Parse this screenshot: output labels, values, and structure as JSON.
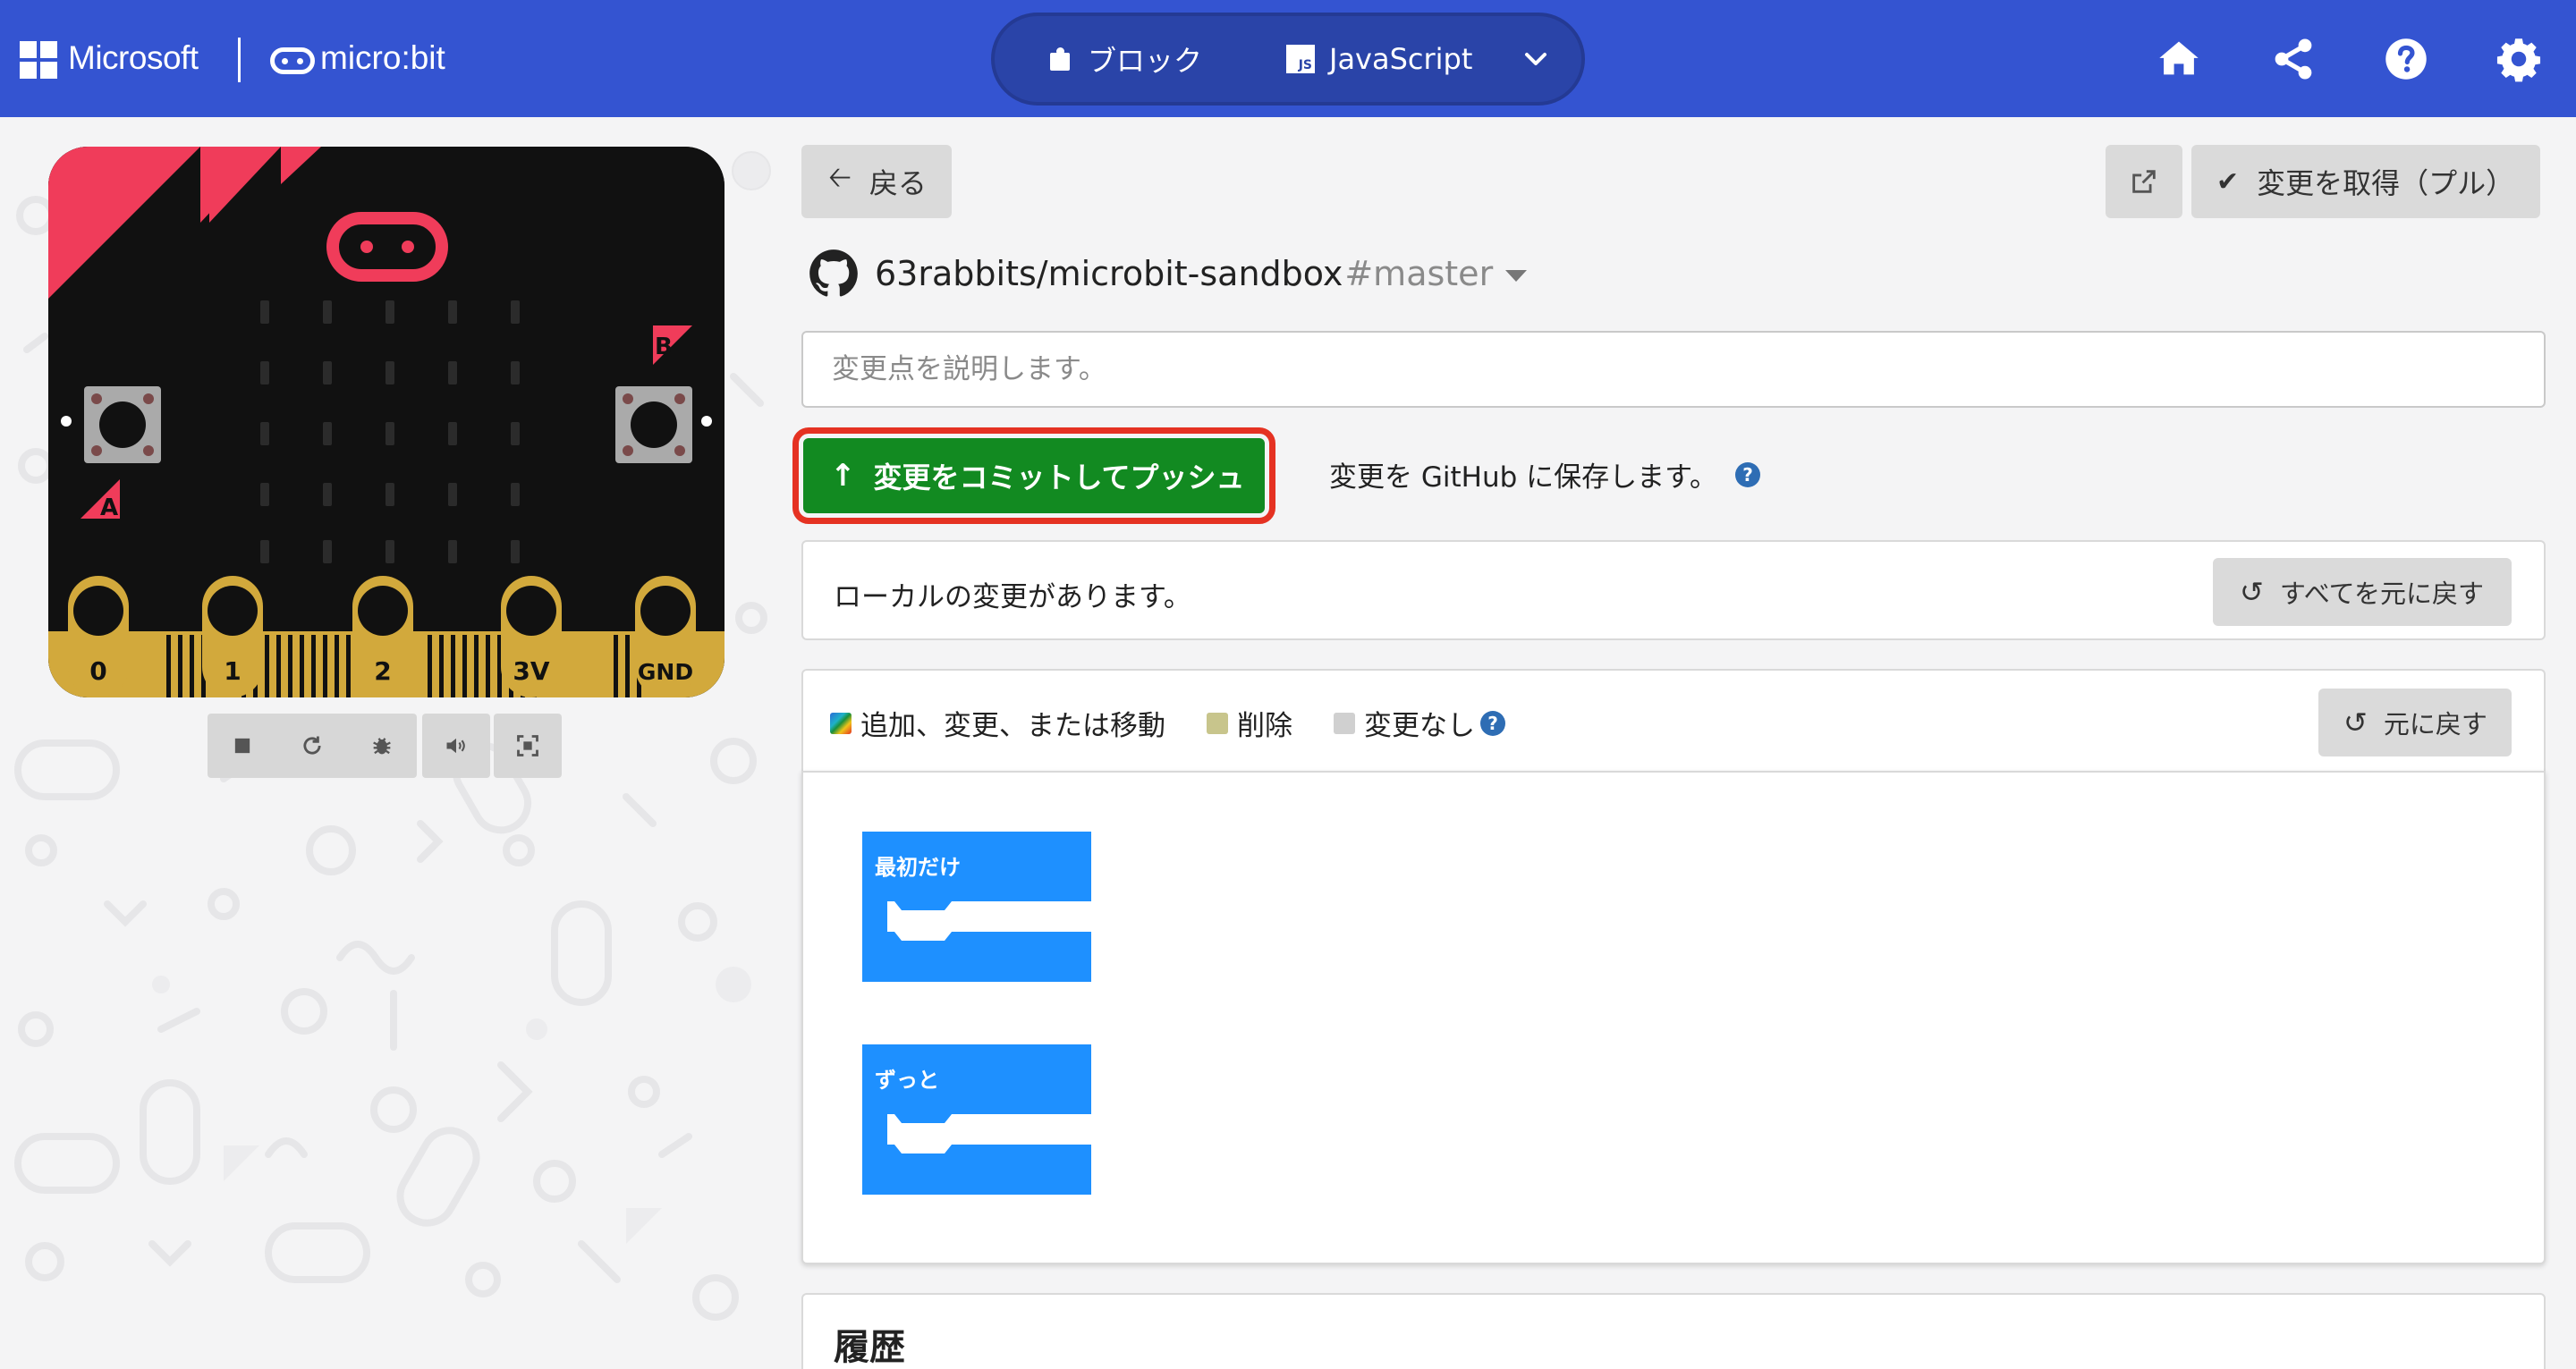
{
  "header": {
    "brand": "Microsoft",
    "product": "micro:bit",
    "modes": [
      {
        "label": "ブロック",
        "icon": "puzzle-icon"
      },
      {
        "label": "JavaScript",
        "icon": "js-icon"
      }
    ],
    "mode_dropdown_icon": "chevron-down-icon",
    "actions": [
      "home-icon",
      "share-icon",
      "help-icon",
      "settings-icon"
    ],
    "accent_color": "#3454d1"
  },
  "simulator": {
    "pin_labels": [
      "0",
      "1",
      "2",
      "3V",
      "GND"
    ],
    "button_labels": [
      "A",
      "B"
    ],
    "controls": [
      "stop-icon",
      "restart-icon",
      "debug-icon",
      "mute-icon",
      "fullscreen-icon"
    ],
    "board_accent": "#f03c5a"
  },
  "github": {
    "back_label": "戻る",
    "pull_label": "変更を取得（プル）",
    "repo": "63rabbits/microbit-sandbox",
    "branch": "#master",
    "description_placeholder": "変更点を説明します。",
    "commit_label": "変更をコミットしてプッシュ",
    "save_note": "変更を GitHub に保存します。",
    "local_changes_text": "ローカルの変更があります。",
    "revert_all_label": "すべてを元に戻す",
    "legend": {
      "added": "追加、変更、または移動",
      "deleted": "削除",
      "unchanged": "変更なし"
    },
    "revert_label": "元に戻す",
    "blocks": [
      {
        "label": "最初だけ"
      },
      {
        "label": "ずっと"
      }
    ],
    "history_title": "履歴",
    "commit_color": "#128a21",
    "highlight_color": "#e53222",
    "block_color": "#1e90ff"
  }
}
